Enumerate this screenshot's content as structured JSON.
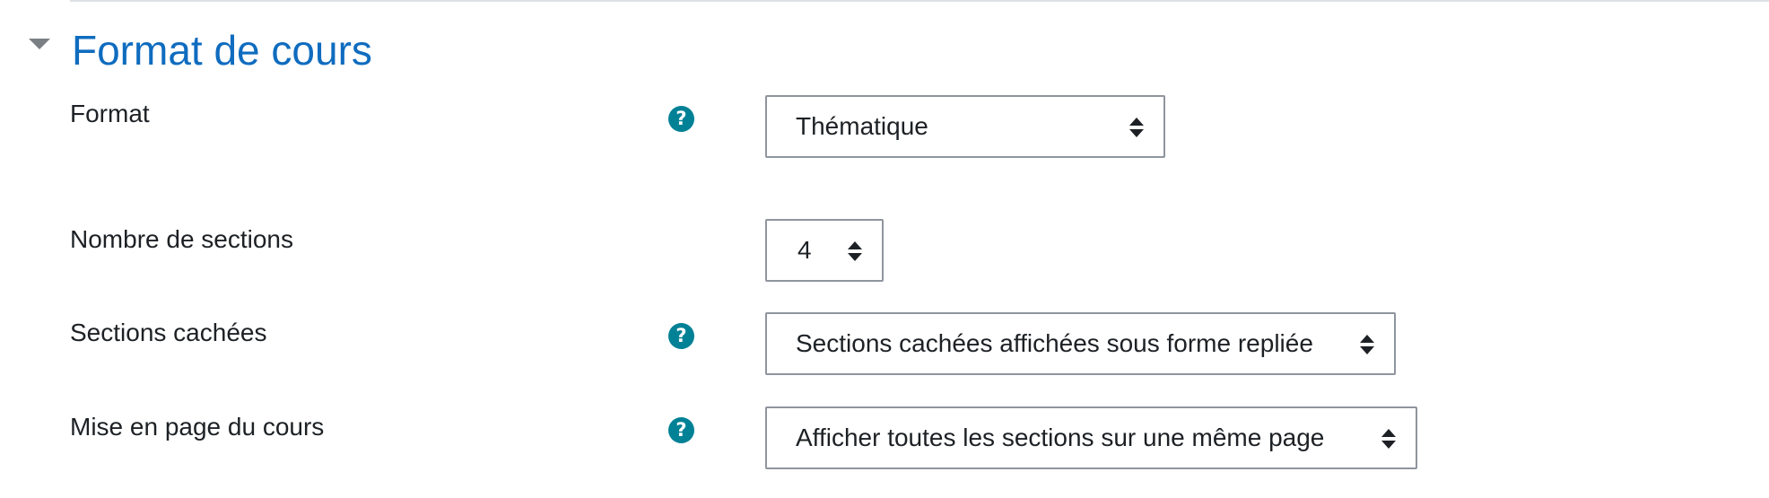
{
  "section": {
    "title": "Format de cours",
    "toggle_icon": "caret-down-icon"
  },
  "fields": {
    "format": {
      "label": "Format",
      "help_icon": "question-circle-icon",
      "value": "Thématique"
    },
    "num_sections": {
      "label": "Nombre de sections",
      "value": "4"
    },
    "hidden_sections": {
      "label": "Sections cachées",
      "help_icon": "question-circle-icon",
      "value": "Sections cachées affichées sous forme repliée"
    },
    "course_layout": {
      "label": "Mise en page du cours",
      "help_icon": "question-circle-icon",
      "value": "Afficher toutes les sections sur une même page"
    }
  },
  "colors": {
    "title": "#0f6cbf",
    "help_icon_bg": "#008196",
    "select_border": "#8f959e",
    "text": "#1d2125"
  }
}
